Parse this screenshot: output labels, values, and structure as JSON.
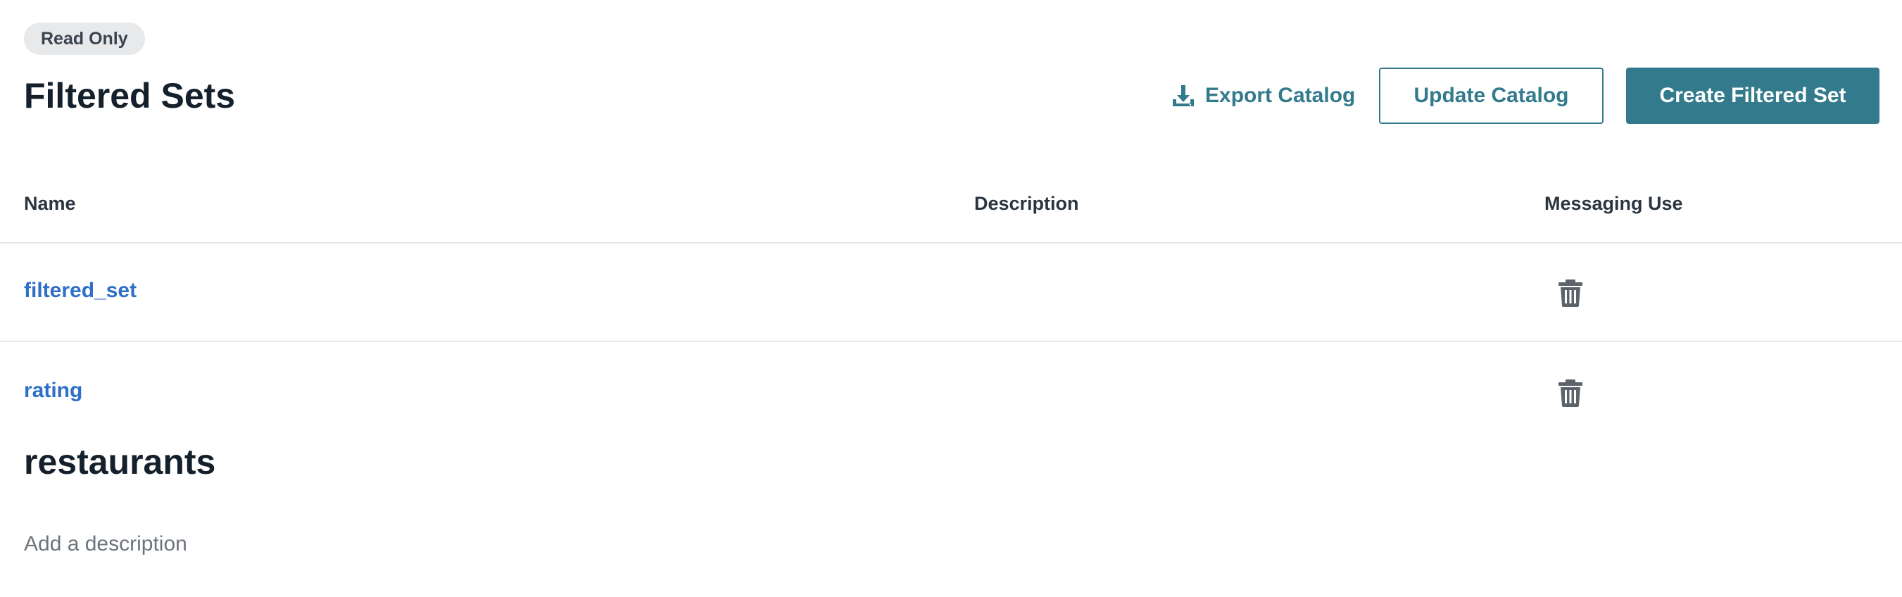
{
  "header": {
    "badge": "Read Only",
    "title": "Filtered Sets",
    "export_label": "Export Catalog",
    "update_label": "Update Catalog",
    "create_label": "Create Filtered Set"
  },
  "table": {
    "columns": {
      "name": "Name",
      "description": "Description",
      "messaging_use": "Messaging Use"
    },
    "rows": [
      {
        "name": "filtered_set",
        "description": "",
        "messaging_use": ""
      },
      {
        "name": "rating",
        "description": "",
        "messaging_use": ""
      }
    ]
  },
  "catalog": {
    "title": "restaurants",
    "description_placeholder": "Add a description"
  },
  "icons": {
    "export": "download-icon",
    "delete": "trash-icon"
  },
  "colors": {
    "accent": "#337b8c",
    "link": "#2e6fc7",
    "badge_bg": "#e8e9ea",
    "divider": "#e4e6e8",
    "trash": "#5c636b"
  }
}
